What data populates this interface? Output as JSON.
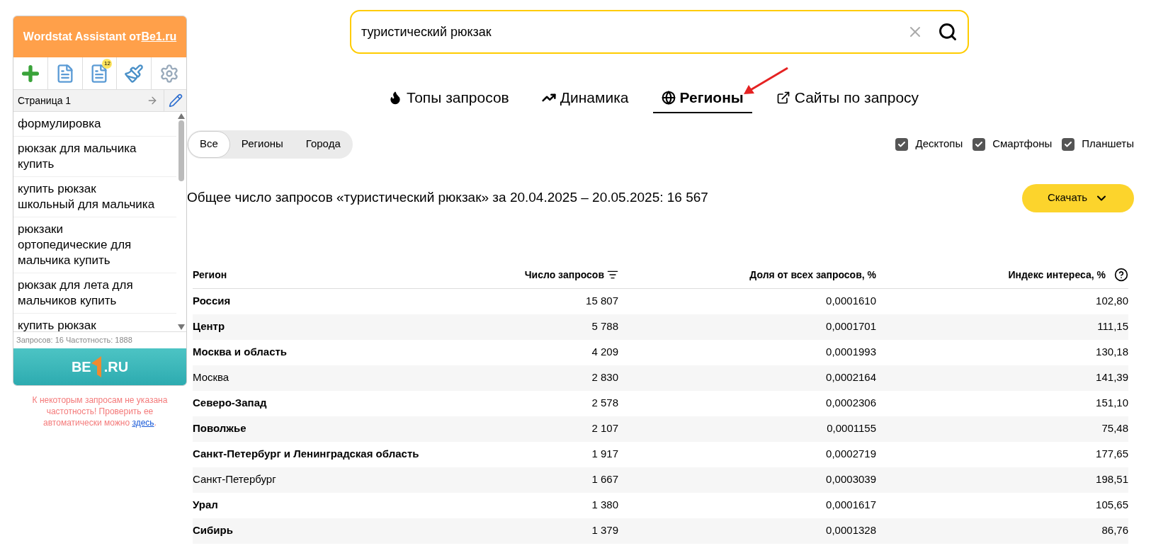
{
  "assistant": {
    "title_prefix": "Wordstat Assistant от ",
    "title_link": "Be1.ru",
    "badge": "12",
    "page_label": "Страница 1",
    "items": [
      "формулировка",
      "рюкзак для мальчика купить",
      "купить рюкзак школьный для мальчика",
      "рюкзаки ортопедические для мальчика купить",
      "рюкзак для лета для мальчиков купить",
      "купить рюкзак"
    ],
    "stats": "Запросов: 16 Частотность: 1888",
    "banner_left": "BE",
    "banner_right": ".RU",
    "note": "К некоторым запросам не указана частотность! Проверить ее автоматически можно ",
    "note_link": "здесь",
    "note_end": "."
  },
  "search": {
    "value": "туристический рюкзак"
  },
  "tabs": [
    {
      "label": "Топы запросов",
      "kind": "fire",
      "selected": false
    },
    {
      "label": "Динамика",
      "kind": "trend",
      "selected": false
    },
    {
      "label": "Регионы",
      "kind": "globe",
      "selected": true
    },
    {
      "label": "Сайты по запросу",
      "kind": "external",
      "selected": false
    }
  ],
  "filters": [
    {
      "label": "Все",
      "selected": true
    },
    {
      "label": "Регионы",
      "selected": false
    },
    {
      "label": "Города",
      "selected": false
    }
  ],
  "devices": [
    {
      "label": "Десктопы",
      "checked": true
    },
    {
      "label": "Смартфоны",
      "checked": true
    },
    {
      "label": "Планшеты",
      "checked": true
    }
  ],
  "summary": "Общее число запросов «туристический рюкзак» за 20.04.2025 – 20.05.2025: 16 567",
  "download": "Скачать",
  "table": {
    "columns": [
      "Регион",
      "Число запросов",
      "Доля от всех запросов, %",
      "Индекс интереса, %"
    ],
    "rows": [
      {
        "kind": "group",
        "cells": [
          "Россия",
          "15 807",
          "0,0001610",
          "102,80"
        ]
      },
      {
        "kind": "group",
        "cells": [
          "Центр",
          "5 788",
          "0,0001701",
          "111,15"
        ]
      },
      {
        "kind": "group",
        "cells": [
          "Москва и область",
          "4 209",
          "0,0001993",
          "130,18"
        ]
      },
      {
        "kind": "city",
        "cells": [
          "Москва",
          "2 830",
          "0,0002164",
          "141,39"
        ]
      },
      {
        "kind": "group",
        "cells": [
          "Северо-Запад",
          "2 578",
          "0,0002306",
          "151,10"
        ]
      },
      {
        "kind": "group",
        "cells": [
          "Поволжье",
          "2 107",
          "0,0001155",
          "75,48"
        ]
      },
      {
        "kind": "group",
        "cells": [
          "Санкт-Петербург и Ленинградская область",
          "1 917",
          "0,0002719",
          "177,65"
        ]
      },
      {
        "kind": "city",
        "cells": [
          "Санкт-Петербург",
          "1 667",
          "0,0003039",
          "198,51"
        ]
      },
      {
        "kind": "group",
        "cells": [
          "Урал",
          "1 380",
          "0,0001617",
          "105,65"
        ]
      },
      {
        "kind": "group",
        "cells": [
          "Сибирь",
          "1 379",
          "0,0001328",
          "86,76"
        ]
      }
    ]
  }
}
